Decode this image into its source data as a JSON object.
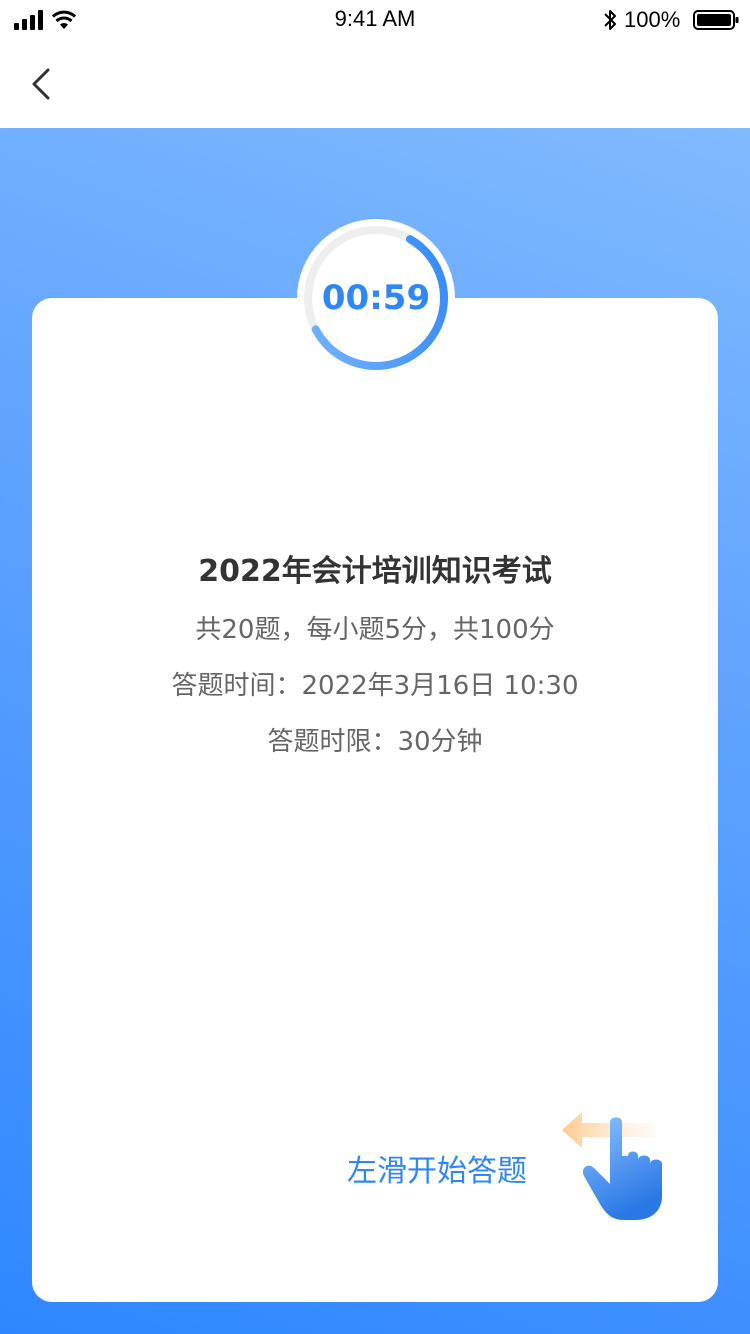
{
  "status_bar": {
    "time": "9:41 AM",
    "battery": "100%"
  },
  "nav": {
    "back_icon": "chevron-left-icon"
  },
  "timer": {
    "value": "00:59",
    "progress": 0.59
  },
  "exam": {
    "title": "2022年会计培训知识考试",
    "summary": "共20题，每小题5分，共100分",
    "time": "答题时间：2022年3月16日  10:30",
    "limit": "答题时限：30分钟"
  },
  "swipe": {
    "label": "左滑开始答题",
    "icon": "hand-swipe-left-icon"
  },
  "colors": {
    "accent": "#2f87f5",
    "bg_top": "#80baff",
    "bg_bottom": "#2f87ff",
    "arrow": "#ffc98c"
  }
}
